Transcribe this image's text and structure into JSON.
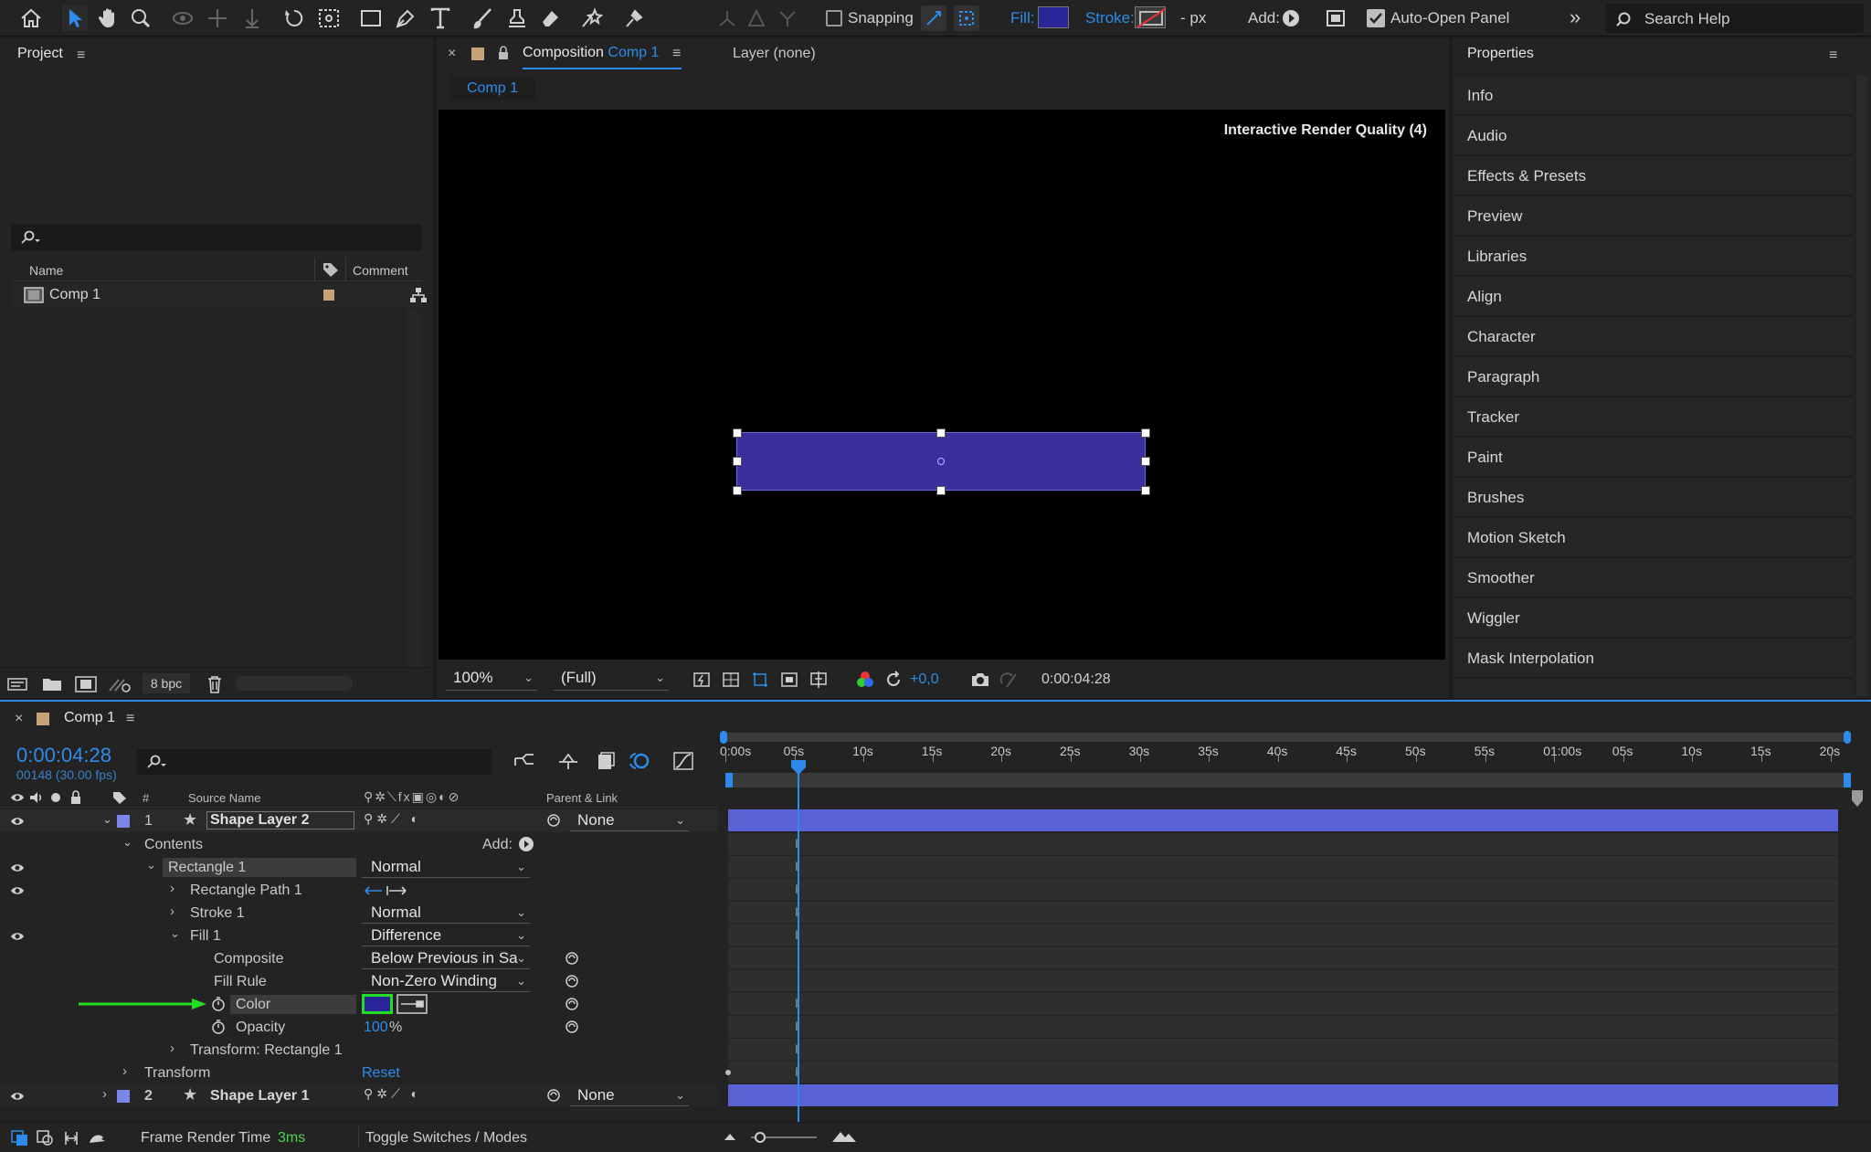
{
  "toolbar": {
    "snapping": "Snapping",
    "fill": "Fill:",
    "stroke": "Stroke:",
    "stroke_px": "- px",
    "add": "Add:",
    "auto_open": "Auto-Open Panel",
    "search_placeholder": "Search Help",
    "fill_color": "#2a2699"
  },
  "project": {
    "title": "Project",
    "columns": {
      "name": "Name",
      "comment": "Comment"
    },
    "items": [
      {
        "name": "Comp 1"
      }
    ],
    "bpc": "8 bpc"
  },
  "composition": {
    "tab_prefix": "Composition",
    "tab_name": "Comp 1",
    "layer_tab": "Layer (none)",
    "sub_tab": "Comp 1",
    "render_quality": "Interactive Render Quality (4)",
    "zoom": "100%",
    "resolution": "(Full)",
    "exposure": "+0,0",
    "timecode": "0:00:04:28",
    "shape_color": "#3a2d9c"
  },
  "properties": {
    "title": "Properties",
    "items": [
      "Info",
      "Audio",
      "Effects & Presets",
      "Preview",
      "Libraries",
      "Align",
      "Character",
      "Paragraph",
      "Tracker",
      "Paint",
      "Brushes",
      "Motion Sketch",
      "Smoother",
      "Wiggler",
      "Mask Interpolation"
    ]
  },
  "timeline": {
    "tab": "Comp 1",
    "timecode": "0:00:04:28",
    "frame_info": "00148 (30.00 fps)",
    "columns": {
      "num": "#",
      "source": "Source Name",
      "parent": "Parent & Link"
    },
    "ruler": [
      "0:00s",
      "05s",
      "10s",
      "15s",
      "20s",
      "25s",
      "30s",
      "35s",
      "40s",
      "45s",
      "50s",
      "55s",
      "01:00s",
      "05s",
      "10s",
      "15s",
      "20s"
    ],
    "layer1": {
      "num": "1",
      "name": "Shape Layer 2",
      "parent": "None"
    },
    "contents": "Contents",
    "add": "Add:",
    "rect1": {
      "name": "Rectangle 1",
      "mode": "Normal"
    },
    "rect_path": "Rectangle Path 1",
    "stroke1": {
      "name": "Stroke 1",
      "mode": "Normal"
    },
    "fill1": {
      "name": "Fill 1",
      "mode": "Difference"
    },
    "composite": {
      "label": "Composite",
      "value": "Below Previous in Sa"
    },
    "fill_rule": {
      "label": "Fill Rule",
      "value": "Non-Zero Winding"
    },
    "color": {
      "label": "Color",
      "value": "#2a2699"
    },
    "opacity": {
      "label": "Opacity",
      "value": "100",
      "unit": "%"
    },
    "transform_rect": "Transform: Rectangle 1",
    "transform": {
      "label": "Transform",
      "reset": "Reset"
    },
    "layer2": {
      "num": "2",
      "name": "Shape Layer 1",
      "parent": "None"
    },
    "frame_render_label": "Frame Render Time",
    "frame_render_value": "3ms",
    "toggle": "Toggle Switches / Modes"
  }
}
